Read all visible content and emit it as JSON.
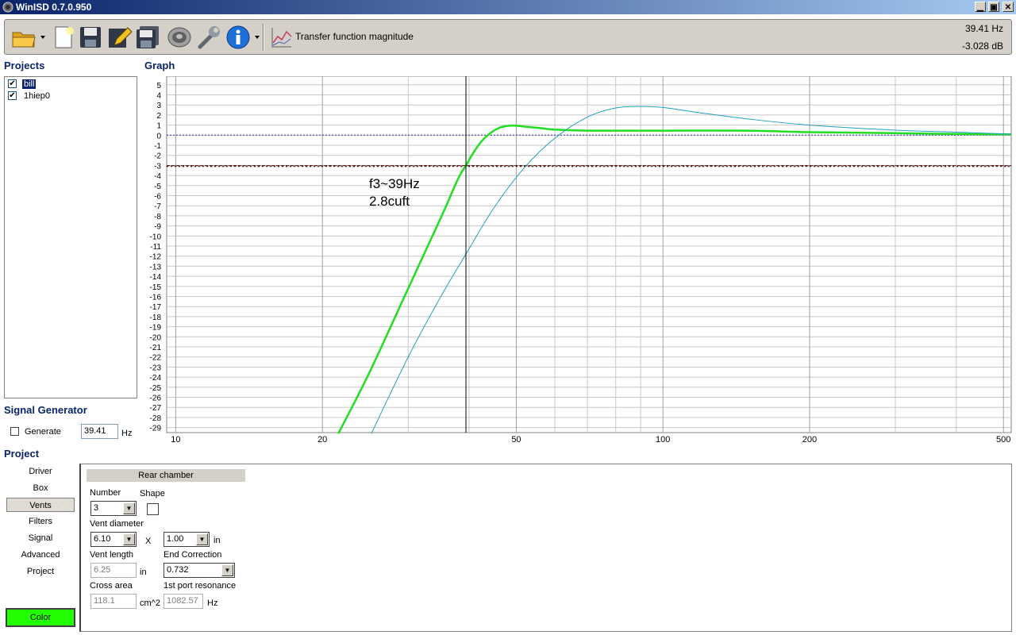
{
  "window": {
    "title": "WinISD 0.7.0.950",
    "min": "▁",
    "max": "▣",
    "close": "✕"
  },
  "toolbar": {
    "plot_label": "Transfer function magnitude",
    "readout_freq": "39.41 Hz",
    "readout_db": "-3.028 dB",
    "icons": [
      "open-folder-icon",
      "dropdown-arrow-icon",
      "new-document-icon",
      "save-icon",
      "edit-pencil-icon",
      "save-all-icon",
      "driver-speaker-icon",
      "tools-wrench-icon",
      "info-icon",
      "dropdown-arrow-icon",
      "transfer-function-icon"
    ]
  },
  "projects": {
    "title": "Projects",
    "items": [
      {
        "label": "bill",
        "checked": true,
        "selected": true
      },
      {
        "label": "1hiep0",
        "checked": true,
        "selected": false
      }
    ]
  },
  "signal_generator": {
    "title": "Signal Generator",
    "generate_label": "Generate",
    "frequency": "39.41",
    "unit": "Hz"
  },
  "graph": {
    "title": "Graph",
    "annotation_line1": "f3~39Hz",
    "annotation_line2": "2.8cuft"
  },
  "chart_data": {
    "type": "line",
    "title": "",
    "xlabel": "",
    "ylabel": "",
    "x_scale": "log",
    "xlim": [
      9.58,
      518.7
    ],
    "ylim": [
      -29.5,
      5.85
    ],
    "x_ticks": [
      10,
      20,
      50,
      100,
      200,
      500
    ],
    "y_ticks": [
      5,
      4,
      3,
      2,
      1,
      0,
      -1,
      -2,
      -3,
      -4,
      -5,
      -6,
      -7,
      -8,
      -9,
      -10,
      -11,
      -12,
      -13,
      -14,
      -15,
      -16,
      -17,
      -18,
      -19,
      -20,
      -21,
      -22,
      -23,
      -24,
      -25,
      -26,
      -27,
      -28,
      -29
    ],
    "grid": true,
    "cursor": {
      "x": 39.41,
      "y": -3.028
    },
    "reference_lines": [
      {
        "y": 0,
        "style": "dotted",
        "color": "#3030a0"
      },
      {
        "y": -3.028,
        "style": "dashed",
        "color": "#800000"
      }
    ],
    "series": [
      {
        "color": "#22dd22",
        "width": 2.5,
        "x": [
          21.56,
          25,
          30,
          35,
          38,
          39.4,
          41,
          43,
          46,
          49,
          52,
          56,
          60,
          70,
          100,
          150,
          200,
          300,
          400,
          518.7
        ],
        "y": [
          -29.6,
          -23.5,
          -15.2,
          -8.2,
          -4.3,
          -3.03,
          -1.6,
          -0.3,
          0.7,
          0.95,
          0.85,
          0.7,
          0.55,
          0.45,
          0.45,
          0.45,
          0.3,
          0.2,
          0.12,
          0.08
        ]
      },
      {
        "color": "#22a0c0",
        "width": 1,
        "x": [
          25.2,
          30,
          35,
          39.4,
          45,
          52,
          60,
          70,
          80,
          90,
          100,
          120,
          150,
          200,
          300,
          400,
          518.7
        ],
        "y": [
          -29.6,
          -22,
          -16,
          -11.8,
          -7.2,
          -3.2,
          -0.3,
          1.8,
          2.7,
          2.85,
          2.75,
          2.2,
          1.6,
          1.0,
          0.5,
          0.3,
          0.1
        ]
      }
    ]
  },
  "project": {
    "title": "Project",
    "nav": [
      "Driver",
      "Box",
      "Vents",
      "Filters",
      "Signal",
      "Advanced",
      "Project"
    ],
    "active_nav": "Vents",
    "color_label": "Color",
    "color_value": "#22ff00"
  },
  "vents": {
    "header": "Rear chamber",
    "number_label": "Number",
    "number_value": "3",
    "shape_label": "Shape",
    "diameter_label": "Vent diameter",
    "diameter_value": "6.10",
    "x_label": "X",
    "multiplier_value": "1.00",
    "in_label": "in",
    "length_label": "Vent length",
    "length_value": "6.25",
    "length_unit": "in",
    "end_correction_label": "End Correction",
    "end_correction_value": "0.732",
    "cross_area_label": "Cross area",
    "cross_area_value": "118.1",
    "cross_area_unit": "cm^2",
    "port_resonance_label": "1st port resonance",
    "port_resonance_value": "1082.57",
    "port_resonance_unit": "Hz"
  }
}
